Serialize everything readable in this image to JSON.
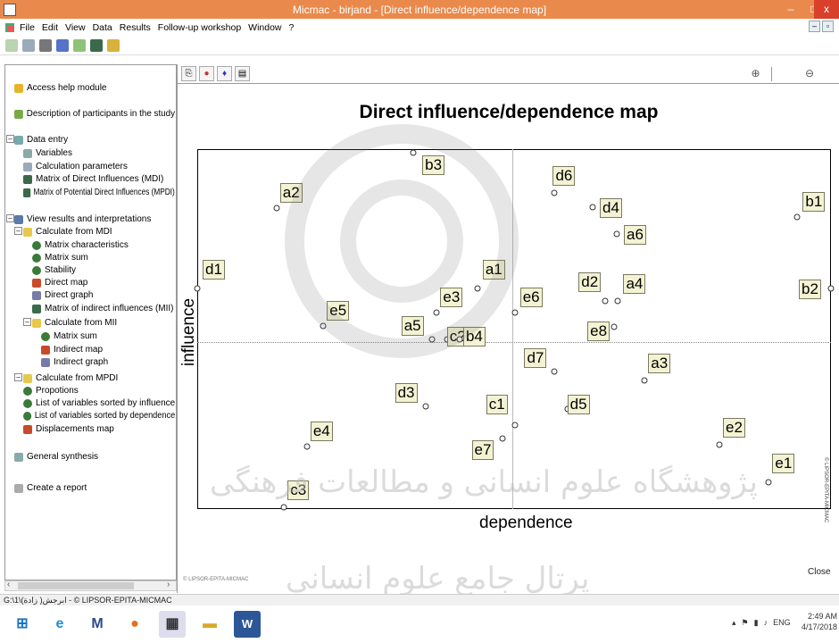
{
  "window": {
    "title": "Micmac   -   birjand - [Direct influence/dependence map]",
    "minimize": "–",
    "maximize": "□",
    "close": "x"
  },
  "menu": [
    "File",
    "Edit",
    "View",
    "Data",
    "Results",
    "Follow-up workshop",
    "Window",
    "?"
  ],
  "tree": [
    {
      "label": "Access help module",
      "icon": "help-icon",
      "level": 0
    },
    {
      "label": "Description of participants in the study",
      "icon": "participants-icon",
      "level": 0
    },
    {
      "label": "Data entry",
      "icon": "data-entry-icon",
      "level": 0
    },
    {
      "label": "Variables",
      "icon": "variables-icon",
      "level": 1
    },
    {
      "label": "Calculation parameters",
      "icon": "parameters-icon",
      "level": 1
    },
    {
      "label": "Matrix of Direct Influences (MDI)",
      "icon": "matrix-icon",
      "level": 1
    },
    {
      "label": "Matrix of Potential Direct Influences (MPDI)",
      "icon": "matrix-icon",
      "level": 1
    },
    {
      "label": "View results and interpretations",
      "icon": "results-icon",
      "level": 0
    },
    {
      "label": "Calculate from MDI",
      "icon": "folder-icon",
      "level": 1
    },
    {
      "label": "Matrix characteristics",
      "icon": "plus-circle-icon",
      "level": 2
    },
    {
      "label": "Matrix sum",
      "icon": "plus-circle-icon",
      "level": 2
    },
    {
      "label": "Stability",
      "icon": "plus-circle-icon",
      "level": 2
    },
    {
      "label": "Direct map",
      "icon": "map-icon",
      "level": 2
    },
    {
      "label": "Direct graph",
      "icon": "graph-icon",
      "level": 2
    },
    {
      "label": "Matrix of indirect influences (MII)",
      "icon": "matrix-icon",
      "level": 2
    },
    {
      "label": "Calculate from MII",
      "icon": "folder-icon",
      "level": 2
    },
    {
      "label": "Matrix sum",
      "icon": "plus-circle-icon",
      "level": 3
    },
    {
      "label": "Indirect map",
      "icon": "map-icon",
      "level": 3
    },
    {
      "label": "Indirect graph",
      "icon": "graph-icon",
      "level": 3
    },
    {
      "label": "Calculate from MPDI",
      "icon": "folder-icon",
      "level": 1
    },
    {
      "label": "Propotions",
      "icon": "plus-circle-icon",
      "level": 1
    },
    {
      "label": "List of variables sorted by influence",
      "icon": "plus-circle-icon",
      "level": 1
    },
    {
      "label": "List of variables sorted by dependence",
      "icon": "plus-circle-icon",
      "level": 1
    },
    {
      "label": "Displacements map",
      "icon": "map-icon",
      "level": 1
    },
    {
      "label": "General synthesis",
      "icon": "synthesis-icon",
      "level": 0
    },
    {
      "label": "Create a report",
      "icon": "report-icon",
      "level": 0
    }
  ],
  "map": {
    "title": "Direct influence/dependence map",
    "xlabel": "dependence",
    "ylabel": "influence",
    "copyright_side": "© LIPSOR-EPITA-MICMAC",
    "footer": "© LIPSOR-EPITA-MICMAC",
    "close_label": "Close"
  },
  "chart_data": {
    "type": "scatter",
    "title": "Direct influence/dependence map",
    "xlabel": "dependence",
    "ylabel": "influence",
    "points": [
      {
        "label": "b3",
        "x": 0.341,
        "y": 0.995
      },
      {
        "label": "a2",
        "x": 0.125,
        "y": 0.84
      },
      {
        "label": "b1",
        "x": 0.947,
        "y": 0.815
      },
      {
        "label": "d6",
        "x": 0.564,
        "y": 0.883
      },
      {
        "label": "d4",
        "x": 0.624,
        "y": 0.843
      },
      {
        "label": "a6",
        "x": 0.662,
        "y": 0.768
      },
      {
        "label": "d1",
        "x": 0.0,
        "y": 0.613
      },
      {
        "label": "a1",
        "x": 0.442,
        "y": 0.613
      },
      {
        "label": "d2",
        "x": 0.644,
        "y": 0.578
      },
      {
        "label": "a4",
        "x": 0.664,
        "y": 0.578
      },
      {
        "label": "b2",
        "x": 1.0,
        "y": 0.613
      },
      {
        "label": "e3",
        "x": 0.378,
        "y": 0.546
      },
      {
        "label": "e6",
        "x": 0.501,
        "y": 0.546
      },
      {
        "label": "e5",
        "x": 0.199,
        "y": 0.508
      },
      {
        "label": "e8",
        "x": 0.658,
        "y": 0.506
      },
      {
        "label": "a5",
        "x": 0.37,
        "y": 0.471
      },
      {
        "label": "c2",
        "x": 0.394,
        "y": 0.471
      },
      {
        "label": "b4",
        "x": 0.414,
        "y": 0.471
      },
      {
        "label": "d7",
        "x": 0.564,
        "y": 0.38
      },
      {
        "label": "a3",
        "x": 0.706,
        "y": 0.355
      },
      {
        "label": "d3",
        "x": 0.36,
        "y": 0.283
      },
      {
        "label": "c1",
        "x": 0.501,
        "y": 0.231
      },
      {
        "label": "d5",
        "x": 0.584,
        "y": 0.276
      },
      {
        "label": "e4",
        "x": 0.173,
        "y": 0.171
      },
      {
        "label": "e2",
        "x": 0.824,
        "y": 0.175
      },
      {
        "label": "e7",
        "x": 0.481,
        "y": 0.193
      },
      {
        "label": "e1",
        "x": 0.902,
        "y": 0.069
      },
      {
        "label": "c3",
        "x": 0.137,
        "y": 0.0
      }
    ]
  },
  "statusbar": "G:\\1\\ابرجش( زادة) - © LIPSOR-EPITA-MICMAC",
  "taskbar": {
    "apps": [
      "start-button",
      "ie-app",
      "mail-app",
      "firefox-app",
      "micmac-app",
      "files-app",
      "word-app"
    ],
    "lang": "ENG",
    "time": "2:49 AM",
    "date": "4/17/2018"
  },
  "colors": {
    "titlebar": "#e98a4c",
    "close": "#d9402a",
    "label_bg": "#f3f3d4"
  }
}
